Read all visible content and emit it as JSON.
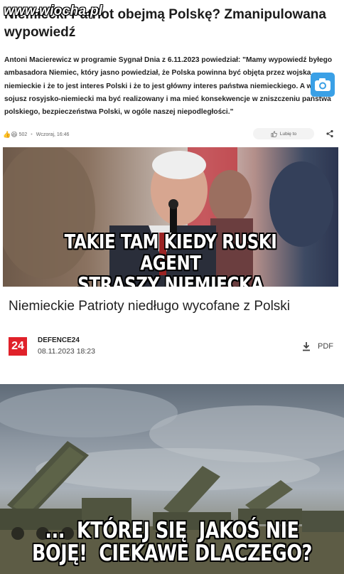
{
  "article1": {
    "headline": "Niemiecki Patriot obejmą Polskę? Zmanipulowana wypowiedź",
    "watermark": "www.wiocha.pl",
    "lead": "Antoni Macierewicz w programie Sygnał Dnia z 6.11.2023 powiedział: \"Mamy wypowiedź byłego ambasadora Niemiec, który jasno powiedział, że Polska powinna być objęta przez wojska niemieckie i że to jest interes Polski i że to jest główny interes państwa niemieckiego. A w ten sojusz rosyjsko-niemiecki ma być realizowany i ma mieć konsekwencje w zniszczeniu państwa polskiego, bezpieczeństwa Polski, w ogóle naszej niepodległości.\"",
    "reactions_count": "502",
    "timestamp": "Wczoraj, 16:46",
    "like_label": "Lubię to",
    "photo_caption": [
      "TAKIE TAM KIEDY RUSKI AGENT",
      "STRASZY NIEMIECKĄ INWAZJĄ..."
    ]
  },
  "article2": {
    "title": "Niemieckie Patrioty niedługo wycofane z Polski",
    "logo_text": "24",
    "source_name": "DEFENCE24",
    "source_date": "08.11.2023 18:23",
    "pdf_label": "PDF",
    "photo_caption": [
      "...  KTÓREJ SIĘ  JAKOŚ NIE",
      "BOJĘ!  CIEKAWE DLACZEGO?"
    ]
  },
  "colors": {
    "logo_red": "#e0212a",
    "badge_blue": "#3aa0e6"
  },
  "icons": [
    "camera-icon",
    "like-icon",
    "share-icon",
    "download-icon"
  ]
}
